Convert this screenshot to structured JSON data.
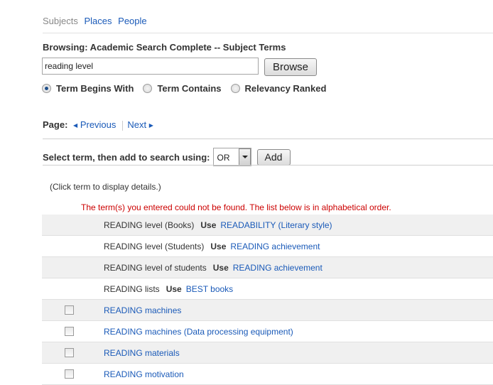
{
  "tabs": [
    {
      "label": "Subjects",
      "active": true
    },
    {
      "label": "Places",
      "active": false
    },
    {
      "label": "People",
      "active": false
    }
  ],
  "browsing_title": "Browsing: Academic Search Complete -- Subject Terms",
  "search": {
    "value": "reading level",
    "button": "Browse"
  },
  "radio_options": [
    {
      "label": "Term Begins With",
      "checked": true
    },
    {
      "label": "Term Contains",
      "checked": false
    },
    {
      "label": "Relevancy Ranked",
      "checked": false
    }
  ],
  "pager": {
    "label": "Page:",
    "previous": "Previous",
    "next": "Next"
  },
  "add_bar": {
    "label": "Select term, then add to search using:",
    "operator": "OR",
    "button": "Add"
  },
  "hint": "(Click term to display details.)",
  "not_found_message": "The term(s) you entered could not be found. The list below is in alphabetical order.",
  "rows": [
    {
      "term": "READING level (Books)",
      "use_label": "Use",
      "use_target": "READABILITY (Literary style)",
      "checkbox": false
    },
    {
      "term": "READING level (Students)",
      "use_label": "Use",
      "use_target": "READING achievement",
      "checkbox": false
    },
    {
      "term": "READING level of students",
      "use_label": "Use",
      "use_target": "READING achievement",
      "checkbox": false
    },
    {
      "term": "READING lists",
      "use_label": "Use",
      "use_target": "BEST books",
      "checkbox": false
    },
    {
      "link": "READING machines",
      "checkbox": true
    },
    {
      "link": "READING machines (Data processing equipment)",
      "checkbox": true
    },
    {
      "link": "READING materials",
      "checkbox": true
    },
    {
      "link": "READING motivation",
      "checkbox": true
    }
  ]
}
